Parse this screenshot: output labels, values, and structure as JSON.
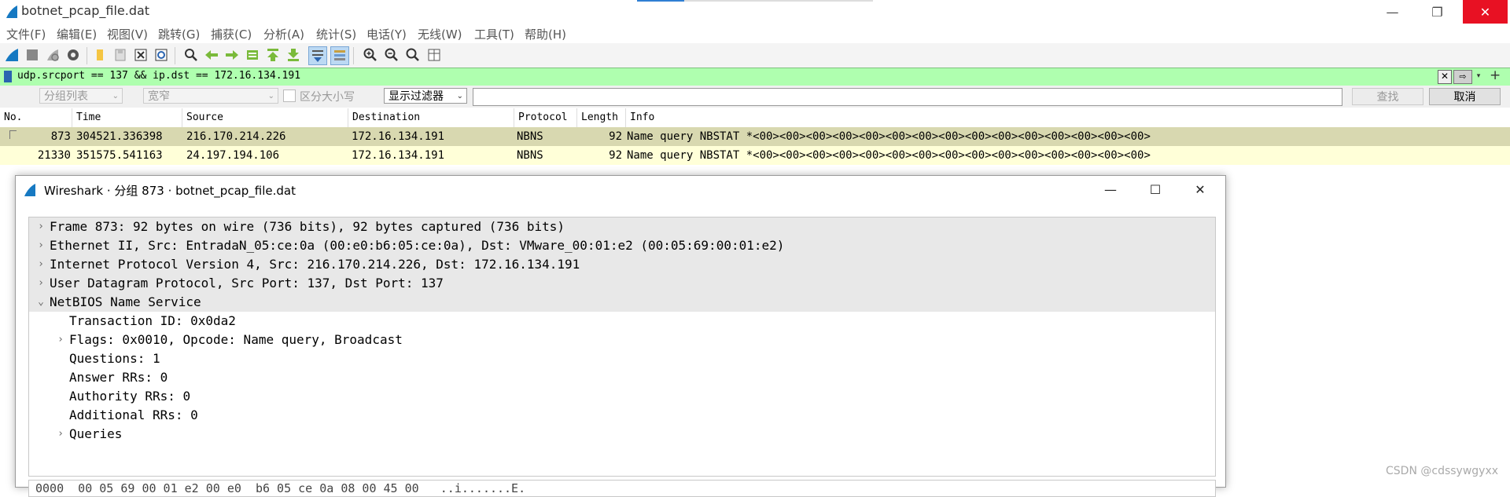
{
  "window": {
    "title": "botnet_pcap_file.dat",
    "minimize_glyph": "—",
    "restore_glyph": "❐",
    "close_glyph": "✕"
  },
  "menu": [
    "文件(F)",
    "编辑(E)",
    "视图(V)",
    "跳转(G)",
    "捕获(C)",
    "分析(A)",
    "统计(S)",
    "电话(Y)",
    "无线(W)",
    "工具(T)",
    "帮助(H)"
  ],
  "toolbar": {
    "icons": [
      "shark-fin-start-icon",
      "stop-capture-icon",
      "restart-capture-icon",
      "capture-options-icon",
      "open-file-icon",
      "save-file-icon",
      "close-file-icon",
      "reload-file-icon",
      "find-packet-icon",
      "go-back-icon",
      "go-forward-icon",
      "go-to-packet-icon",
      "go-first-icon",
      "go-last-icon",
      "auto-scroll-icon",
      "colorize-icon",
      "zoom-in-icon",
      "zoom-out-icon",
      "zoom-normal-icon",
      "resize-columns-icon"
    ]
  },
  "filter": {
    "text": "udp.srcport == 137 && ip.dst == 172.16.134.191",
    "clear_glyph": "✕",
    "apply_glyph": "⇨",
    "dropdown_glyph": "▾",
    "add_glyph": "+",
    "color": "#afffaf"
  },
  "findbar": {
    "list_combo": "分组列表",
    "charset_combo": "宽窄",
    "case_label": "区分大小写",
    "type_combo": "显示过滤器",
    "search_value": "",
    "find_button": "查找",
    "cancel_button": "取消"
  },
  "packet_list": {
    "headers": [
      "No.",
      "Time",
      "Source",
      "Destination",
      "Protocol",
      "Length",
      "Info"
    ],
    "rows": [
      {
        "no": "873",
        "time": "304521.336398",
        "src": "216.170.214.226",
        "dst": "172.16.134.191",
        "proto": "NBNS",
        "len": "92",
        "info": "Name query NBSTAT *<00><00><00><00><00><00><00><00><00><00><00><00><00><00><00>",
        "bg": "#d8d8b0"
      },
      {
        "no": "21330",
        "time": "351575.541163",
        "src": "24.197.194.106",
        "dst": "172.16.134.191",
        "proto": "NBNS",
        "len": "92",
        "info": "Name query NBSTAT *<00><00><00><00><00><00><00><00><00><00><00><00><00><00><00>",
        "bg": "#ffffd8"
      }
    ]
  },
  "detail_window": {
    "title": "Wireshark · 分组 873 · botnet_pcap_file.dat",
    "minimize_glyph": "—",
    "maximize_glyph": "☐",
    "close_glyph": "✕",
    "tree": [
      {
        "level": 0,
        "expander": "›",
        "text": "Frame 873: 92 bytes on wire (736 bits), 92 bytes captured (736 bits)",
        "selected": true
      },
      {
        "level": 0,
        "expander": "›",
        "text": "Ethernet II, Src: EntradaN_05:ce:0a (00:e0:b6:05:ce:0a), Dst: VMware_00:01:e2 (00:05:69:00:01:e2)",
        "selected": true
      },
      {
        "level": 0,
        "expander": "›",
        "text": "Internet Protocol Version 4, Src: 216.170.214.226, Dst: 172.16.134.191",
        "selected": true
      },
      {
        "level": 0,
        "expander": "›",
        "text": "User Datagram Protocol, Src Port: 137, Dst Port: 137",
        "selected": true
      },
      {
        "level": 0,
        "expander": "⌄",
        "text": "NetBIOS Name Service",
        "selected": true
      },
      {
        "level": 1,
        "expander": "",
        "text": "Transaction ID: 0x0da2",
        "selected": false
      },
      {
        "level": 1,
        "expander": "›",
        "text": "Flags: 0x0010, Opcode: Name query, Broadcast",
        "selected": false
      },
      {
        "level": 1,
        "expander": "",
        "text": "Questions: 1",
        "selected": false
      },
      {
        "level": 1,
        "expander": "",
        "text": "Answer RRs: 0",
        "selected": false
      },
      {
        "level": 1,
        "expander": "",
        "text": "Authority RRs: 0",
        "selected": false
      },
      {
        "level": 1,
        "expander": "",
        "text": "Additional RRs: 0",
        "selected": false
      },
      {
        "level": 1,
        "expander": "›",
        "text": "Queries",
        "selected": false
      }
    ],
    "hex_line": "0000  00 05 69 00 01 e2 00 e0  b6 05 ce 0a 08 00 45 00   ..i.......E."
  },
  "watermark": "CSDN @cdssywgyxx"
}
